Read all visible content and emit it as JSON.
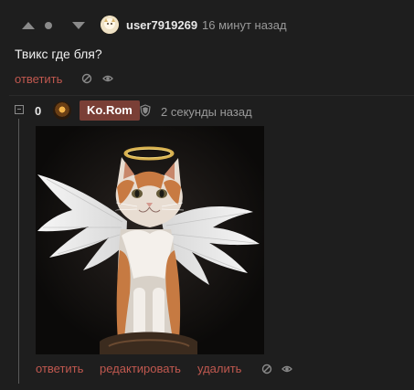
{
  "comment": {
    "username": "user7919269",
    "time": "16 минут назад",
    "text": "Твикс где бля?",
    "actions": {
      "reply": "ответить"
    }
  },
  "reply": {
    "score": "0",
    "username": "Ko.Rom",
    "time": "2 секунды назад",
    "actions": {
      "reply": "ответить",
      "edit": "редактировать",
      "delete": "удалить"
    }
  },
  "colors": {
    "background": "#1e1e1e",
    "link": "#c0584f",
    "badge": "#7a3f36",
    "muted": "#9a9a9a",
    "text": "#f0f0f0"
  },
  "icons": [
    "up-arrow-icon",
    "dot-icon",
    "down-arrow-icon",
    "ban-icon",
    "eye-icon",
    "shield-icon",
    "collapse-icon"
  ]
}
